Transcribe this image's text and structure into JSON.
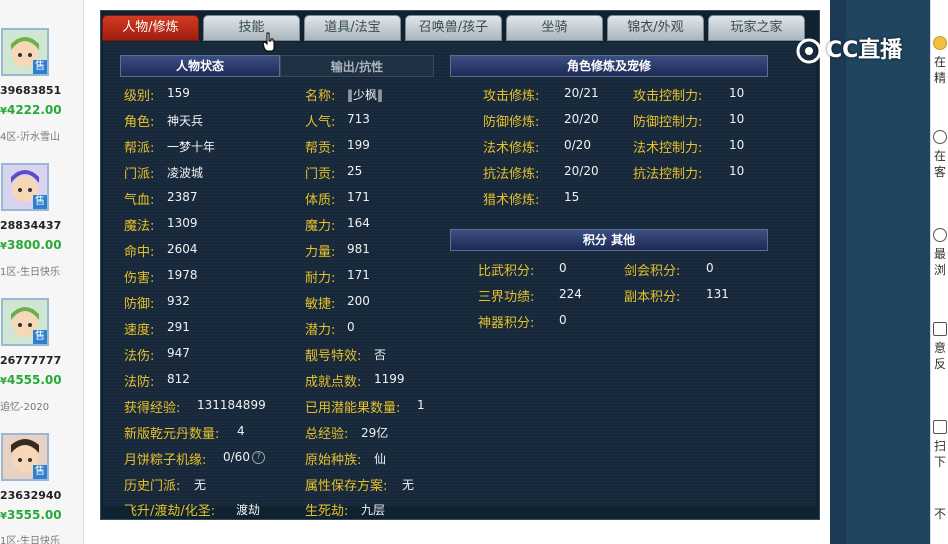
{
  "tabs": [
    {
      "label": "人物/修炼"
    },
    {
      "label": "技能"
    },
    {
      "label": "道具/法宝"
    },
    {
      "label": "召唤兽/孩子"
    },
    {
      "label": "坐骑"
    },
    {
      "label": "锦衣/外观"
    },
    {
      "label": "玩家之家"
    }
  ],
  "watermark": {
    "text": "CC直播"
  },
  "char_status": {
    "title": "人物状态",
    "subtitle": "输出/抗性",
    "left": [
      {
        "label": "级别:",
        "value": "159"
      },
      {
        "label": "角色:",
        "value": "神天兵"
      },
      {
        "label": "帮派:",
        "value": "一梦十年"
      },
      {
        "label": "门派:",
        "value": "凌波城"
      },
      {
        "label": "气血:",
        "value": "2387"
      },
      {
        "label": "魔法:",
        "value": "1309"
      },
      {
        "label": "命中:",
        "value": "2604"
      },
      {
        "label": "伤害:",
        "value": "1978"
      },
      {
        "label": "防御:",
        "value": "932"
      },
      {
        "label": "速度:",
        "value": "291"
      },
      {
        "label": "法伤:",
        "value": "947"
      },
      {
        "label": "法防:",
        "value": "812"
      },
      {
        "label": "获得经验:",
        "value": "131184899"
      },
      {
        "label": "新版乾元丹数量:",
        "value": "4"
      },
      {
        "label": "月饼粽子机缘:",
        "value": "0/60"
      },
      {
        "label": "历史门派:",
        "value": "无"
      },
      {
        "label": "飞升/渡劫/化圣:",
        "value": "渡劫"
      }
    ],
    "right": [
      {
        "label": "名称:",
        "value": "‖少枫‖"
      },
      {
        "label": "人气:",
        "value": "713"
      },
      {
        "label": "帮贡:",
        "value": "199"
      },
      {
        "label": "门贡:",
        "value": "25"
      },
      {
        "label": "体质:",
        "value": "171"
      },
      {
        "label": "魔力:",
        "value": "164"
      },
      {
        "label": "力量:",
        "value": "981"
      },
      {
        "label": "耐力:",
        "value": "171"
      },
      {
        "label": "敏捷:",
        "value": "200"
      },
      {
        "label": "潜力:",
        "value": "0"
      },
      {
        "label": "靓号特效:",
        "value": "否"
      },
      {
        "label": "成就点数:",
        "value": "1199"
      },
      {
        "label": "已用潜能果数量:",
        "value": "1"
      },
      {
        "label": "总经验:",
        "value": "29亿"
      },
      {
        "label": "原始种族:",
        "value": "仙"
      },
      {
        "label": "属性保存方案:",
        "value": "无"
      },
      {
        "label": "生死劫:",
        "value": "九层"
      }
    ]
  },
  "cultivation": {
    "title": "角色修炼及宠修",
    "left": [
      {
        "label": "攻击修炼:",
        "value": "20/21"
      },
      {
        "label": "防御修炼:",
        "value": "20/20"
      },
      {
        "label": "法术修炼:",
        "value": "0/20"
      },
      {
        "label": "抗法修炼:",
        "value": "20/20"
      },
      {
        "label": "猎术修炼:",
        "value": "15"
      }
    ],
    "right": [
      {
        "label": "攻击控制力:",
        "value": "10"
      },
      {
        "label": "防御控制力:",
        "value": "10"
      },
      {
        "label": "法术控制力:",
        "value": "10"
      },
      {
        "label": "抗法控制力:",
        "value": "10"
      }
    ]
  },
  "points": {
    "title": "积分 其他",
    "left": [
      {
        "label": "比武积分:",
        "value": "0"
      },
      {
        "label": "三界功绩:",
        "value": "224"
      },
      {
        "label": "神器积分:",
        "value": "0"
      }
    ],
    "right": [
      {
        "label": "剑会积分:",
        "value": "0"
      },
      {
        "label": "副本积分:",
        "value": "131"
      }
    ]
  },
  "sellers": [
    {
      "id": "39683851",
      "price": "4222.00",
      "server": "4区-沂水雪山",
      "tag": "售"
    },
    {
      "id": "28834437",
      "price": "3800.00",
      "server": "1区-生日快乐",
      "tag": "售"
    },
    {
      "id": "26777777",
      "price": "4555.00",
      "server": "追忆-2020",
      "tag": "售"
    },
    {
      "id": "23632940",
      "price": "3555.00",
      "server": "1区-生日快乐",
      "tag": "售"
    }
  ],
  "right_sidebar": [
    {
      "text": "在\n精"
    },
    {
      "text": "在\n客"
    },
    {
      "text": "最\n浏"
    },
    {
      "text": "意\n反"
    },
    {
      "text": "扫\n下"
    },
    {
      "text": "不"
    }
  ]
}
